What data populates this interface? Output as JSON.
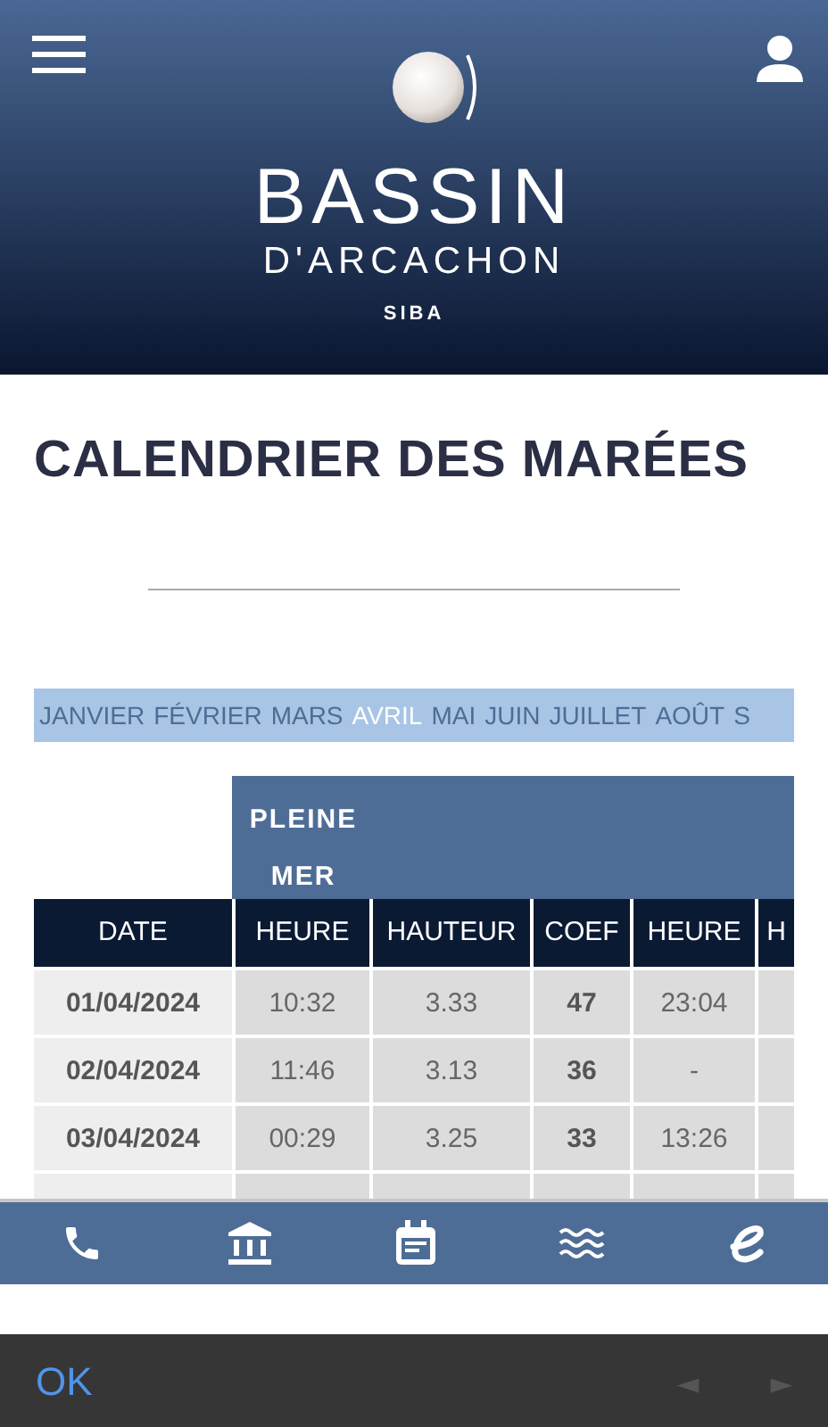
{
  "header": {
    "brand": "BASSIN",
    "subtitle": "D'ARCACHON",
    "tagline": "SIBA"
  },
  "page_title": "CALENDRIER DES MARÉES",
  "months": [
    {
      "label": "JANVIER",
      "selected": false
    },
    {
      "label": "FÉVRIER",
      "selected": false
    },
    {
      "label": "MARS",
      "selected": false
    },
    {
      "label": "AVRIL",
      "selected": true
    },
    {
      "label": "MAI",
      "selected": false
    },
    {
      "label": "JUIN",
      "selected": false
    },
    {
      "label": "JUILLET",
      "selected": false
    },
    {
      "label": "AOÛT",
      "selected": false
    },
    {
      "label": "S",
      "selected": false
    }
  ],
  "table": {
    "group_header": "PLEINE MER",
    "columns": [
      "DATE",
      "HEURE",
      "HAUTEUR",
      "COEF",
      "HEURE",
      "H"
    ],
    "rows": [
      [
        "01/04/2024",
        "10:32",
        "3.33",
        "47",
        "23:04",
        ""
      ],
      [
        "02/04/2024",
        "11:46",
        "3.13",
        "36",
        "-",
        ""
      ],
      [
        "03/04/2024",
        "00:29",
        "3.25",
        "33",
        "13:26",
        ""
      ]
    ]
  },
  "bottom_nav": [
    {
      "kind": "phone"
    },
    {
      "kind": "building"
    },
    {
      "kind": "calendar"
    },
    {
      "kind": "waves"
    },
    {
      "kind": "e"
    }
  ],
  "dialog_bar": {
    "ok": "OK",
    "prev": "◄",
    "next": "►"
  }
}
